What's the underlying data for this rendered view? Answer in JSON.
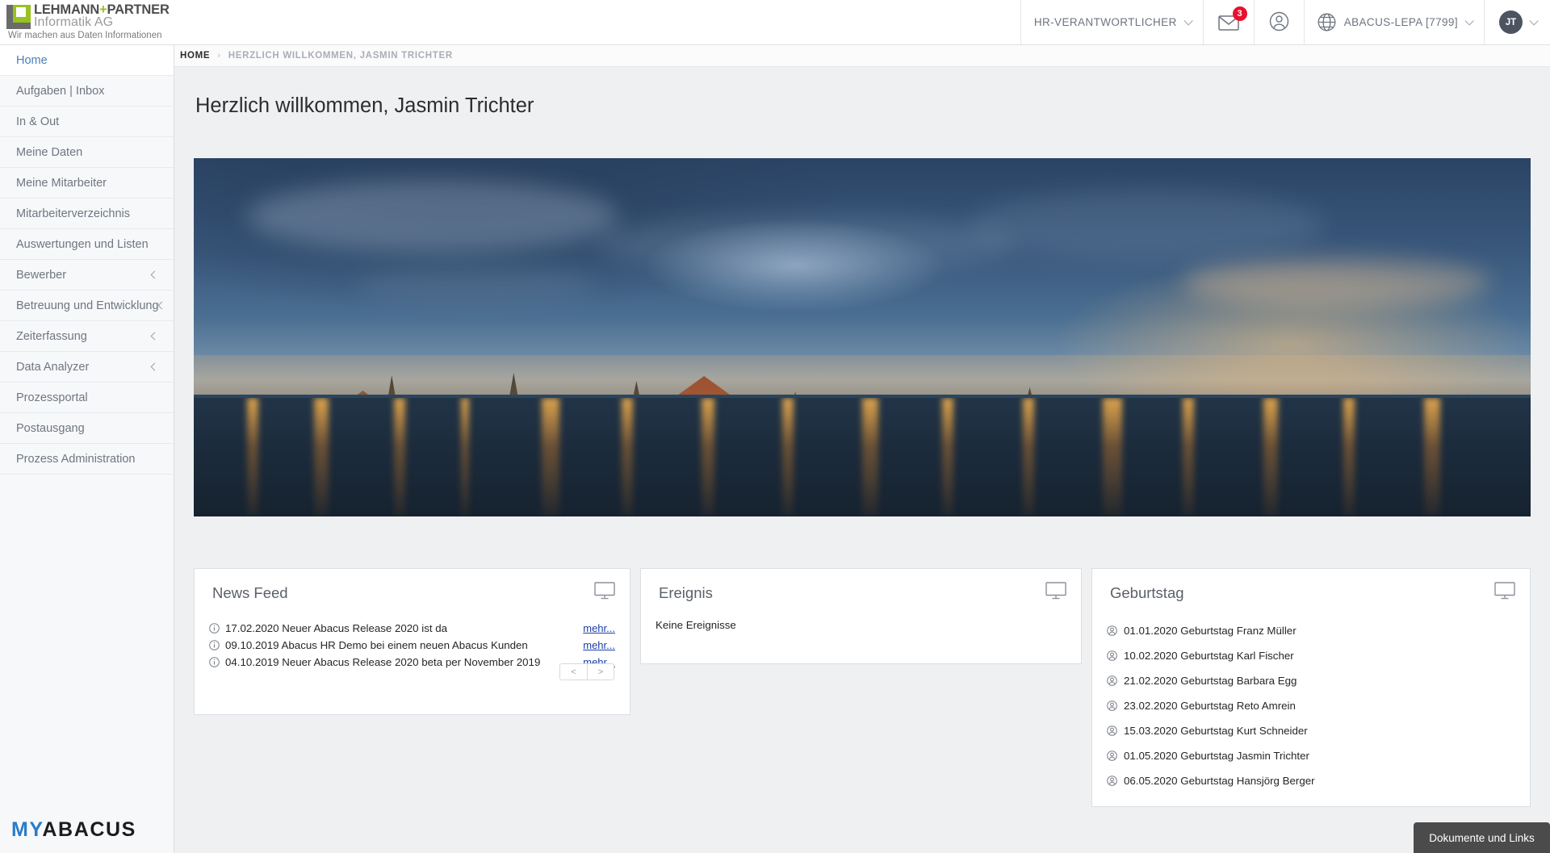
{
  "brand": {
    "line1_a": "LEHMANN",
    "line1_plus": "+",
    "line1_b": "PARTNER",
    "line2": "Informatik AG",
    "tagline": "Wir machen aus Daten Informationen",
    "accent_green": "#98c21e"
  },
  "header": {
    "role_selector": "HR-VERANTWORTLICHER",
    "mail_badge_count": "3",
    "client_selector": "ABACUS-LEPA [7799]",
    "user_initials": "JT",
    "icons": {
      "mail": "mail-icon",
      "person": "person-circle-icon",
      "globe": "globe-icon"
    }
  },
  "sidebar": {
    "items": [
      {
        "label": "Home",
        "active": true,
        "expandable": false
      },
      {
        "label": "Aufgaben | Inbox",
        "active": false,
        "expandable": false
      },
      {
        "label": "In & Out",
        "active": false,
        "expandable": false
      },
      {
        "label": "Meine Daten",
        "active": false,
        "expandable": false
      },
      {
        "label": "Meine Mitarbeiter",
        "active": false,
        "expandable": false
      },
      {
        "label": "Mitarbeiterverzeichnis",
        "active": false,
        "expandable": false
      },
      {
        "label": "Auswertungen und Listen",
        "active": false,
        "expandable": false
      },
      {
        "label": "Bewerber",
        "active": false,
        "expandable": true
      },
      {
        "label": "Betreuung und Entwicklung",
        "active": false,
        "expandable": true
      },
      {
        "label": "Zeiterfassung",
        "active": false,
        "expandable": true
      },
      {
        "label": "Data Analyzer",
        "active": false,
        "expandable": true
      },
      {
        "label": "Prozessportal",
        "active": false,
        "expandable": false
      },
      {
        "label": "Postausgang",
        "active": false,
        "expandable": false
      },
      {
        "label": "Prozess Administration",
        "active": false,
        "expandable": false
      }
    ],
    "footer_logo_my": "MY",
    "footer_logo_abacus": "ABACUS",
    "footer_logo_accent": "#2a7cc7"
  },
  "breadcrumb": {
    "home": "HOME",
    "separator": "›",
    "current": "HERZLICH WILLKOMMEN, JASMIN TRICHTER"
  },
  "page": {
    "title": "Herzlich willkommen, Jasmin Trichter",
    "hero_alt": "Panorama Luzern bei Daemmerung"
  },
  "widgets": {
    "news": {
      "title": "News Feed",
      "monitor_icon": "monitor-icon",
      "items": [
        {
          "icon": "info-circle-icon",
          "date": "17.02.2020",
          "text": "Neuer Abacus Release 2020 ist da",
          "more": "mehr..."
        },
        {
          "icon": "info-circle-icon",
          "date": "09.10.2019",
          "text": "Abacus HR Demo bei einem neuen Abacus Kunden",
          "more": "mehr..."
        },
        {
          "icon": "info-circle-icon",
          "date": "04.10.2019",
          "text": "Neuer Abacus Release 2020 beta per November 2019",
          "more": "mehr..."
        }
      ],
      "pager_prev": "<",
      "pager_next": ">"
    },
    "events": {
      "title": "Ereignis",
      "monitor_icon": "monitor-icon",
      "empty_text": "Keine Ereignisse"
    },
    "birthdays": {
      "title": "Geburtstag",
      "monitor_icon": "monitor-icon",
      "items": [
        {
          "icon": "person-circle-icon",
          "date": "01.01.2020",
          "text": "Geburtstag Franz Müller"
        },
        {
          "icon": "person-circle-icon",
          "date": "10.02.2020",
          "text": "Geburtstag Karl Fischer"
        },
        {
          "icon": "person-circle-icon",
          "date": "21.02.2020",
          "text": "Geburtstag Barbara Egg"
        },
        {
          "icon": "person-circle-icon",
          "date": "23.02.2020",
          "text": "Geburtstag Reto Amrein"
        },
        {
          "icon": "person-circle-icon",
          "date": "15.03.2020",
          "text": "Geburtstag Kurt Schneider"
        },
        {
          "icon": "person-circle-icon",
          "date": "01.05.2020",
          "text": "Geburtstag Jasmin Trichter"
        },
        {
          "icon": "person-circle-icon",
          "date": "06.05.2020",
          "text": "Geburtstag Hansjörg Berger"
        }
      ]
    }
  },
  "footer": {
    "docs_button": "Dokumente und Links"
  },
  "colors": {
    "page_bg": "#eef0f2",
    "sidebar_bg": "#f7f8fa",
    "active_nav": "#4a7fb5",
    "badge_red": "#e8112d",
    "link_blue": "#1b3fa8",
    "docbtn_bg": "#4b4b4b"
  }
}
